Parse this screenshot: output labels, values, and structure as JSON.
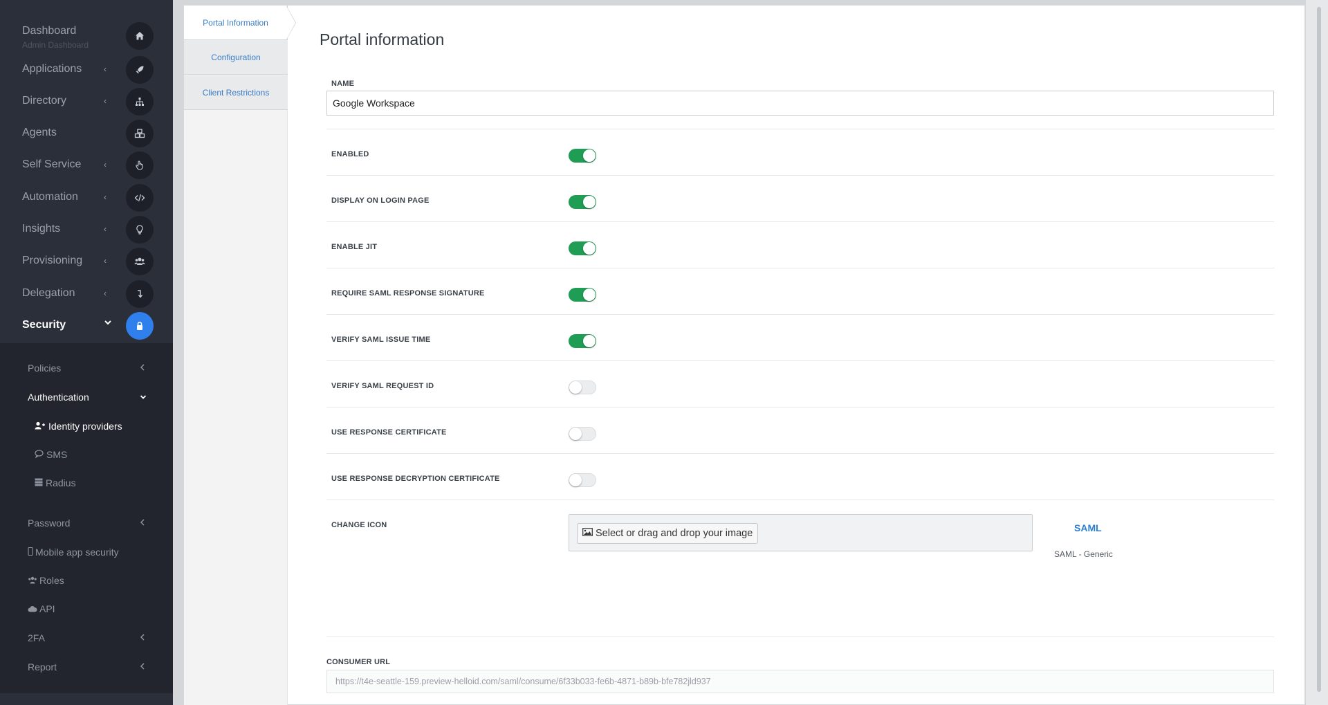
{
  "sidebar": {
    "dashboard": {
      "label": "Dashboard",
      "sublabel": "Admin Dashboard",
      "icon": "home-icon"
    },
    "items": [
      {
        "label": "Applications",
        "chevron": "‹",
        "icon": "rocket-icon"
      },
      {
        "label": "Directory",
        "chevron": "‹",
        "icon": "sitemap-icon"
      },
      {
        "label": "Agents",
        "chevron": "",
        "icon": "cubes-icon"
      },
      {
        "label": "Self Service",
        "chevron": "‹",
        "icon": "hand-pointer-icon"
      },
      {
        "label": "Automation",
        "chevron": "‹",
        "icon": "code-icon"
      },
      {
        "label": "Insights",
        "chevron": "‹",
        "icon": "lightbulb-icon"
      },
      {
        "label": "Provisioning",
        "chevron": "‹",
        "icon": "users-icon"
      },
      {
        "label": "Delegation",
        "chevron": "‹",
        "icon": "arrow-turn-icon"
      },
      {
        "label": "Security",
        "chevron": "⌄",
        "icon": "lock-icon"
      }
    ],
    "security_sub": {
      "policies": "Policies",
      "authentication": "Authentication",
      "identity_providers": "Identity providers",
      "sms": "SMS",
      "radius": "Radius",
      "password": "Password",
      "mobile_app_security": "Mobile app security",
      "roles": "Roles",
      "api": "API",
      "twofa": "2FA",
      "report": "Report"
    }
  },
  "tabs": [
    {
      "label": "Portal Information",
      "active": true
    },
    {
      "label": "Configuration",
      "active": false
    },
    {
      "label": "Client Restrictions",
      "active": false
    }
  ],
  "form": {
    "title": "Portal information",
    "name_label": "NAME",
    "name_value": "Google Workspace",
    "toggles": [
      {
        "label": "ENABLED",
        "on": true
      },
      {
        "label": "DISPLAY ON LOGIN PAGE",
        "on": true
      },
      {
        "label": "ENABLE JIT",
        "on": true
      },
      {
        "label": "REQUIRE SAML RESPONSE SIGNATURE",
        "on": true
      },
      {
        "label": "VERIFY SAML ISSUE TIME",
        "on": true
      },
      {
        "label": "VERIFY SAML REQUEST ID",
        "on": false
      },
      {
        "label": "USE RESPONSE CERTIFICATE",
        "on": false
      },
      {
        "label": "USE RESPONSE DECRYPTION CERTIFICATE",
        "on": false
      }
    ],
    "change_icon_label": "CHANGE ICON",
    "icon_button_label": "Select or drag and drop your image",
    "icon_preview_title": "SAML",
    "icon_preview_subtitle": "SAML - Generic",
    "consumer_url_label": "CONSUMER URL",
    "consumer_url_value": "https://t4e-seattle-159.preview-helloid.com/saml/consume/6f33b033-fe6b-4871-b89b-bfe782jld937"
  },
  "colors": {
    "accent": "#2f80ed",
    "toggle_on": "#1f9d55",
    "link": "#3a7cc3"
  }
}
